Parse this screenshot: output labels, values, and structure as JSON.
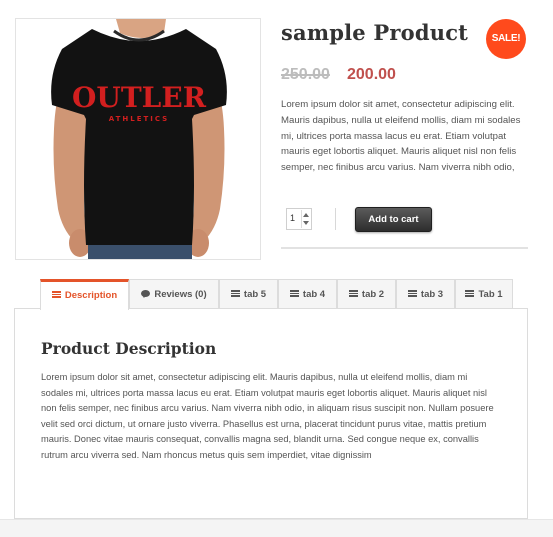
{
  "product": {
    "title": "sample Product",
    "sale_badge": "SALE!",
    "price_old": "250.00",
    "price_new": "200.00",
    "short_description": "Lorem ipsum dolor sit amet, consectetur adipiscing elit. Mauris dapibus, nulla ut eleifend mollis, diam mi sodales mi, ultrices porta massa lacus eu erat. Etiam volutpat mauris eget lobortis aliquet. Mauris aliquet nisl non felis semper, nec finibus arcu varius. Nam viverra nibh odio,",
    "quantity": "1",
    "add_to_cart_label": "Add to cart",
    "image": {
      "shirt_text": "OUTLER",
      "shirt_subtext": "ATHLETICS"
    }
  },
  "tabs": [
    {
      "label": "Description",
      "icon": "lines-icon",
      "active": true
    },
    {
      "label": "Reviews (0)",
      "icon": "chat-bubble-icon",
      "active": false
    },
    {
      "label": "tab 5",
      "icon": "lines-icon",
      "active": false
    },
    {
      "label": "tab 4",
      "icon": "lines-icon",
      "active": false
    },
    {
      "label": "tab 2",
      "icon": "lines-icon",
      "active": false
    },
    {
      "label": "tab 3",
      "icon": "lines-icon",
      "active": false
    },
    {
      "label": "Tab 1",
      "icon": "lines-icon",
      "active": false
    }
  ],
  "panel": {
    "title": "Product Description",
    "body": "Lorem ipsum dolor sit amet, consectetur adipiscing elit. Mauris dapibus, nulla ut eleifend mollis, diam mi sodales mi, ultrices porta massa lacus eu erat. Etiam volutpat mauris eget lobortis aliquet. Mauris aliquet nisl non felis semper, nec finibus arcu varius. Nam viverra nibh odio, in aliquam risus suscipit non. Nullam posuere velit sed orci dictum, ut ornare justo viverra. Phasellus est urna, placerat tincidunt purus vitae, mattis pretium mauris. Donec vitae mauris consequat, convallis magna sed, blandit urna. Sed congue neque ex, convallis rutrum arcu viverra sed. Nam rhoncus metus quis sem imperdiet, vitae dignissim"
  },
  "colors": {
    "accent": "#e4542a",
    "sale_badge": "#ff4a1c",
    "price_new": "#c0504d",
    "price_old": "#bcbcbc"
  }
}
